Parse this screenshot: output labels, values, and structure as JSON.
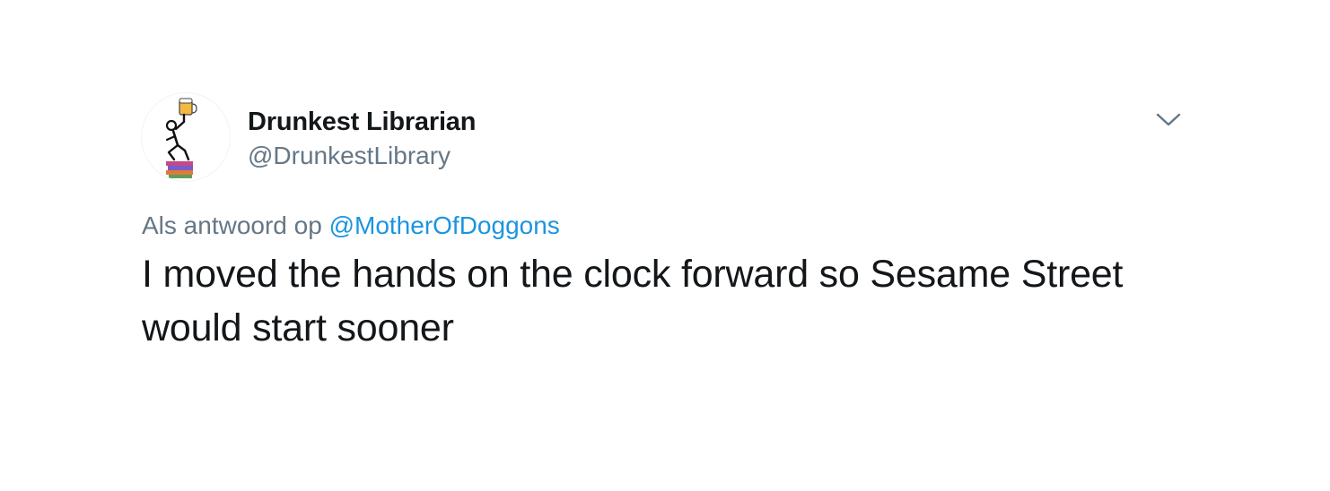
{
  "tweet": {
    "author": {
      "display_name": "Drunkest Librarian",
      "handle": "@DrunkestLibrary",
      "avatar_icon": "stick-figure-on-books-with-beer-icon"
    },
    "menu_icon": "chevron-down-icon",
    "reply_context": {
      "prefix": "Als antwoord op",
      "mention": "@MotherOfDoggons"
    },
    "text": "I moved the hands on the clock forward so Sesame Street would start sooner"
  },
  "colors": {
    "text_primary": "#14171a",
    "text_secondary": "#657786",
    "link": "#1b95e0",
    "background": "#ffffff"
  }
}
